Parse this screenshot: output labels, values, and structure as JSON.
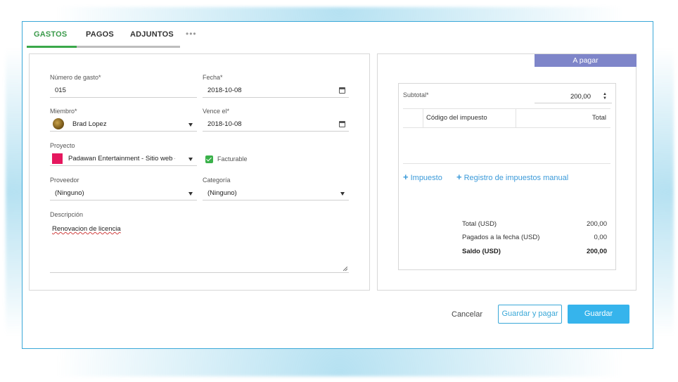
{
  "tabs": [
    {
      "label": "GASTOS",
      "active": true
    },
    {
      "label": "PAGOS"
    },
    {
      "label": "ADJUNTOS"
    }
  ],
  "tabs_more_label": "•••",
  "form": {
    "expense_number": {
      "label": "Número de gasto*",
      "value": "015"
    },
    "date": {
      "label": "Fecha*",
      "value": "2018-10-08"
    },
    "member": {
      "label": "Miembro*",
      "value": "Brad Lopez"
    },
    "due_date": {
      "label": "Vence el*",
      "value": "2018-10-08"
    },
    "project": {
      "label": "Proyecto",
      "value": "Padawan Entertainment - Sitio web - Co",
      "color": "#e5175e"
    },
    "billable": {
      "label": "Facturable",
      "checked": true
    },
    "supplier": {
      "label": "Proveedor",
      "value": "(Ninguno)"
    },
    "category": {
      "label": "Categoría",
      "value": "(Ninguno)"
    },
    "description": {
      "label": "Descripción",
      "value": "Renovacion de licencia"
    }
  },
  "summary": {
    "to_pay_label": "A pagar",
    "subtotal_label": "Subtotal*",
    "subtotal_value": "200,00",
    "tax_table": {
      "col_code": "Código del impuesto",
      "col_total": "Total"
    },
    "add_tax_label": "Impuesto",
    "manual_tax_label": "Registro de impuestos manual",
    "totals": [
      {
        "label": "Total (USD)",
        "value": "200,00"
      },
      {
        "label": "Pagados a la fecha (USD)",
        "value": "0,00"
      },
      {
        "label": "Saldo (USD)",
        "value": "200,00"
      }
    ]
  },
  "actions": {
    "cancel": "Cancelar",
    "save_and_pay": "Guardar y pagar",
    "save": "Guardar"
  },
  "colors": {
    "accent": "#36b4ec",
    "active_tab": "#3aa84a",
    "to_pay_header": "#7e85c9"
  }
}
